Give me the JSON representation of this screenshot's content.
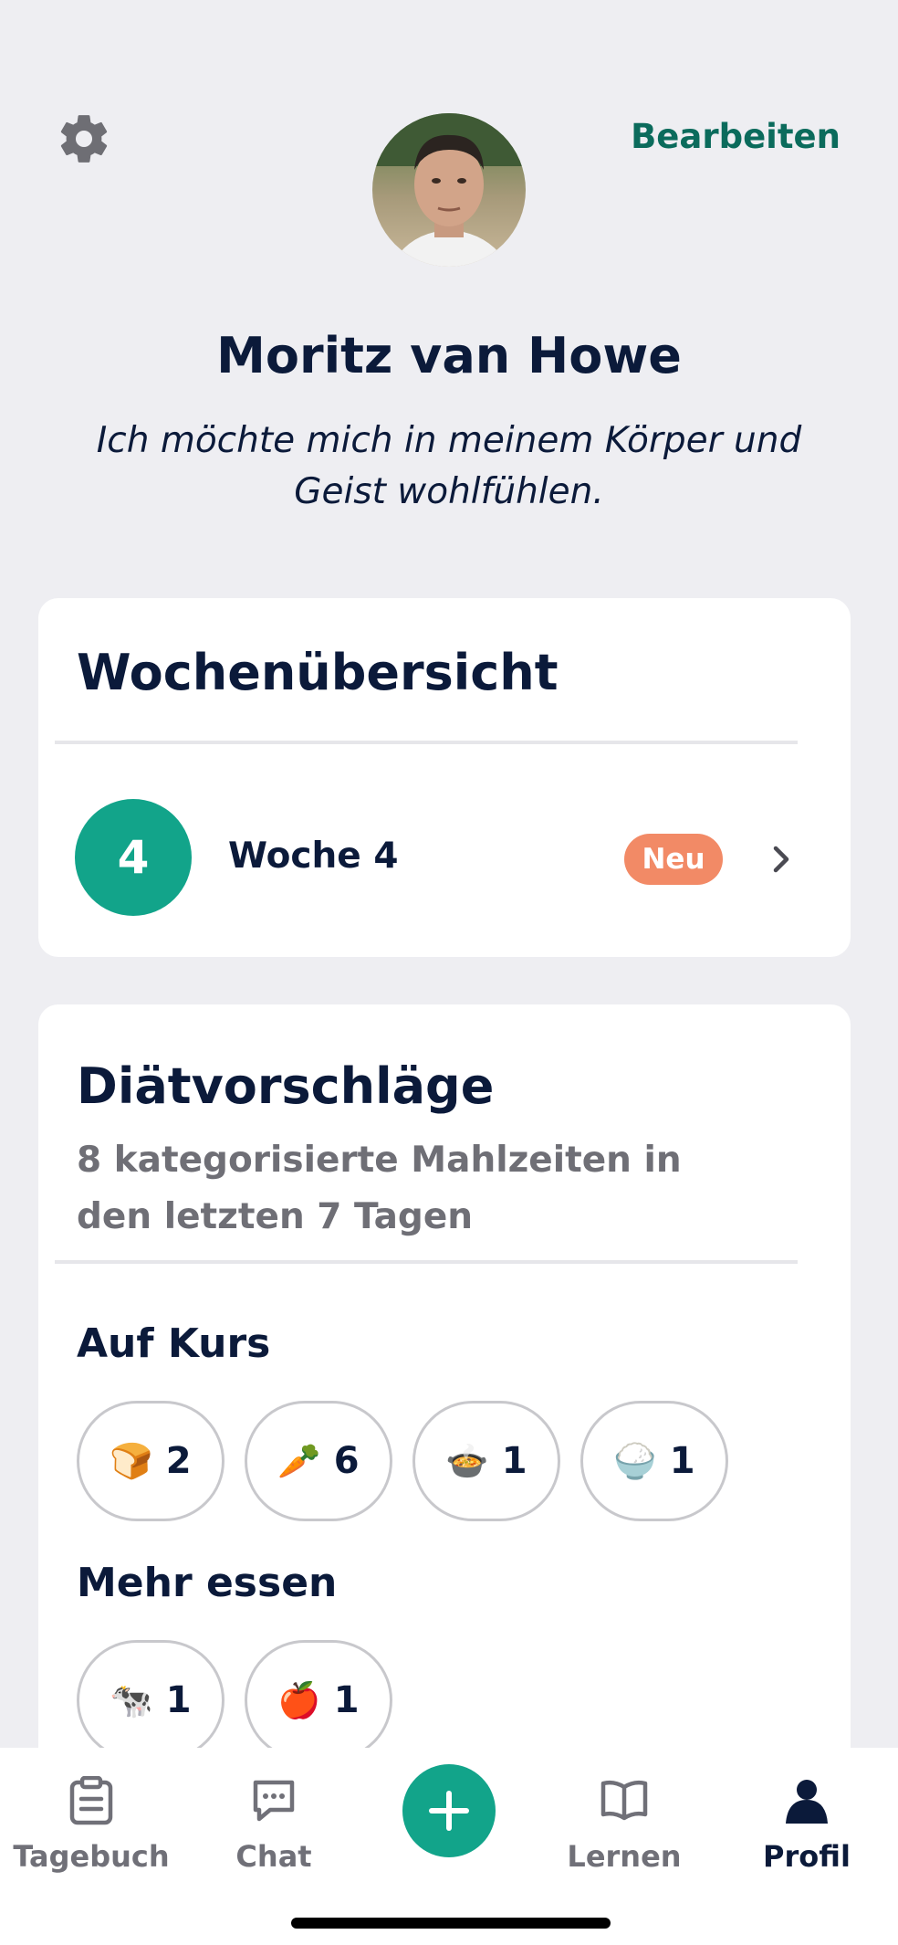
{
  "header": {
    "edit_label": "Bearbeiten",
    "settings_icon": "gear-icon"
  },
  "profile": {
    "name": "Moritz van Howe",
    "motto": "Ich möchte mich in meinem Körper und Geist wohlfühlen."
  },
  "week_overview": {
    "title": "Wochenübersicht",
    "week_number": "4",
    "week_label": "Woche 4",
    "badge": "Neu"
  },
  "diet": {
    "title": "Diätvorschläge",
    "subtitle": "8 kategorisierte Mahlzeiten in den letzten 7 Tagen",
    "on_track": {
      "label": "Auf Kurs",
      "items": [
        {
          "emoji": "🍞",
          "icon": "bread-icon",
          "count": "2"
        },
        {
          "emoji": "🥕",
          "icon": "carrot-icon",
          "count": "6"
        },
        {
          "emoji": "🍲",
          "icon": "soup-bowl-icon",
          "count": "1"
        },
        {
          "emoji": "🍚",
          "icon": "rice-bowl-icon",
          "count": "1"
        }
      ]
    },
    "eat_more": {
      "label": "Mehr essen",
      "items": [
        {
          "emoji": "🐄",
          "icon": "cow-icon",
          "count": "1"
        },
        {
          "emoji": "🍎",
          "icon": "apple-icon",
          "count": "1"
        }
      ]
    }
  },
  "tabbar": {
    "tabs": [
      {
        "label": "Tagebuch",
        "icon": "clipboard-icon"
      },
      {
        "label": "Chat",
        "icon": "chat-icon"
      },
      {
        "label": "Lernen",
        "icon": "book-icon"
      },
      {
        "label": "Profil",
        "icon": "person-icon"
      }
    ],
    "add_icon": "plus-icon",
    "active_tab": "Profil"
  },
  "colors": {
    "accent": "#12A48A",
    "edit_link": "#0B6B5C",
    "badge": "#F28A66",
    "text": "#0B1A3A",
    "background": "#EEEEF2"
  }
}
